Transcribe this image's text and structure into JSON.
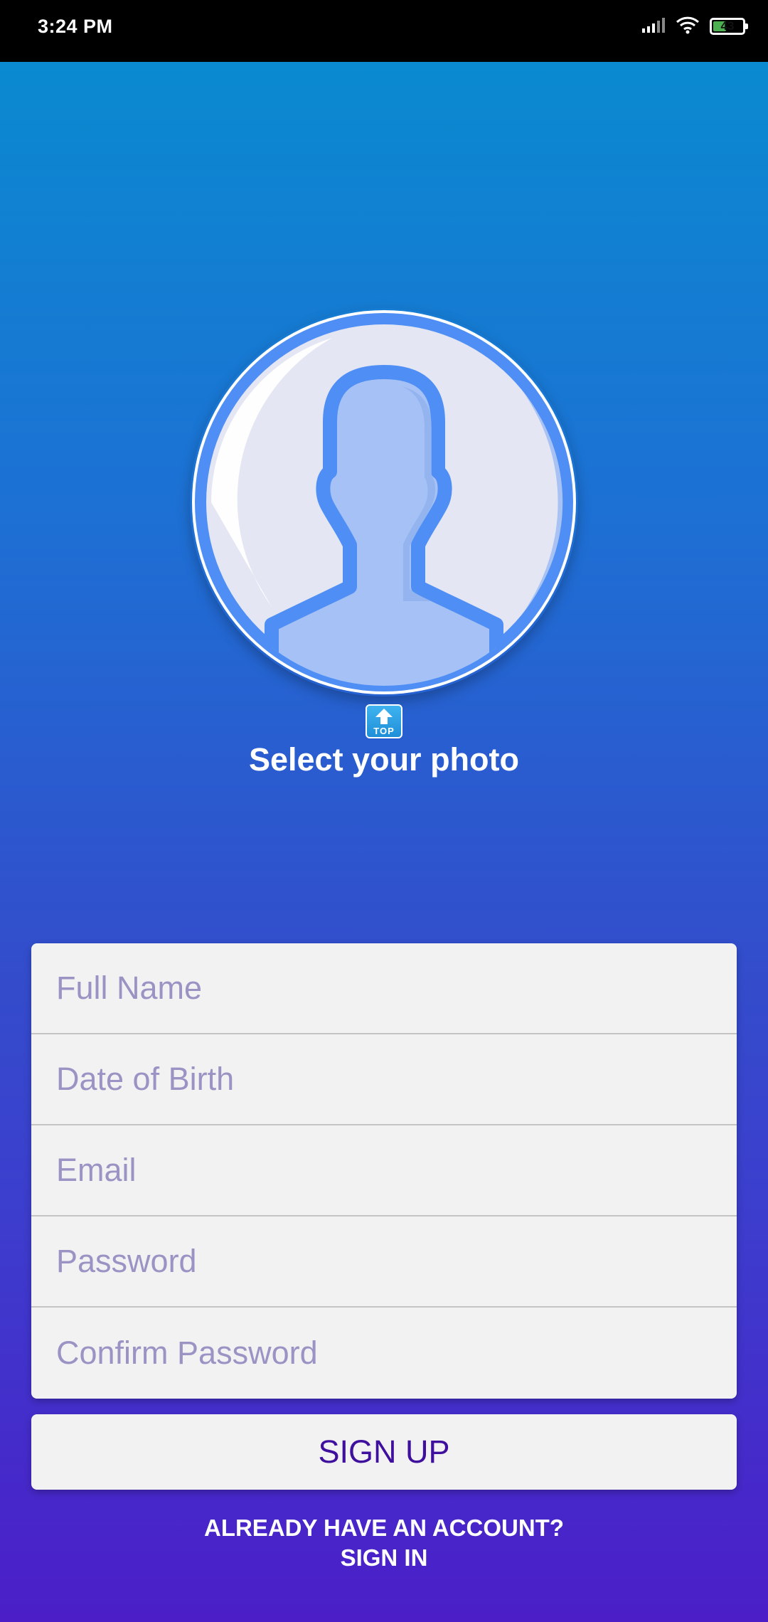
{
  "status_bar": {
    "time": "3:24 PM",
    "battery_level": "43",
    "icons": [
      "signal-icon",
      "wifi-icon",
      "battery-icon"
    ]
  },
  "profile": {
    "avatar_icon": "person-silhouette-icon",
    "upload_icon": "top-arrow-icon",
    "upload_icon_text": "TOP",
    "select_photo_label": "Select your photo"
  },
  "form": {
    "full_name_placeholder": "Full Name",
    "dob_placeholder": "Date of Birth",
    "email_placeholder": "Email",
    "password_placeholder": "Password",
    "confirm_password_placeholder": "Confirm Password"
  },
  "actions": {
    "signup_label": "SIGN UP",
    "signin_prompt": "ALREADY HAVE AN ACCOUNT?",
    "signin_label": "SIGN IN"
  },
  "colors": {
    "gradient_top": "#0a8ad0",
    "gradient_bottom": "#4b1ec8",
    "placeholder": "#9b93c4",
    "signup_text": "#3f0f9e",
    "card_bg": "#f2f2f2"
  }
}
